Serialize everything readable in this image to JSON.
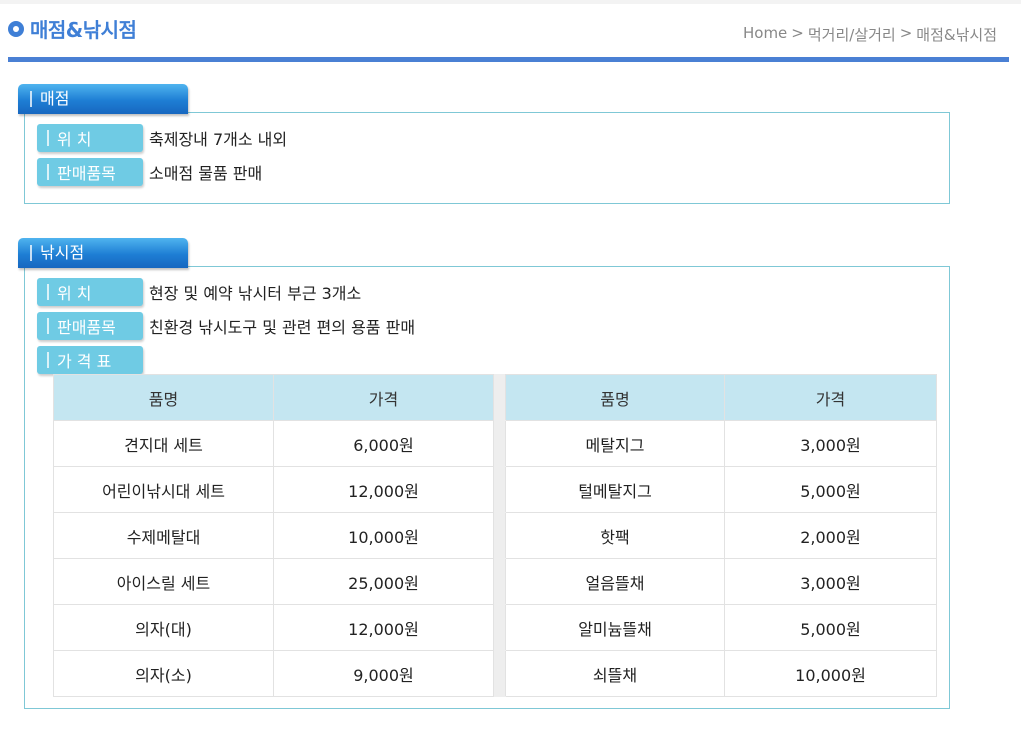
{
  "header": {
    "title": "매점&낚시점",
    "breadcrumb": [
      "Home",
      "먹거리/살거리",
      "매점&낚시점"
    ],
    "breadcrumb_sep": ">"
  },
  "sections": [
    {
      "tab": "매점",
      "rows": [
        {
          "label": "위 치",
          "value": "축제장내 7개소 내외"
        },
        {
          "label": "판매품목",
          "value": "소매점 물품 판매"
        }
      ]
    },
    {
      "tab": "낚시점",
      "rows": [
        {
          "label": "위 치",
          "value": "현장 및 예약 낚시터 부근 3개소"
        },
        {
          "label": "판매품목",
          "value": "친환경 낚시도구 및 관련 편의 용품 판매"
        },
        {
          "label": "가 격 표",
          "value": ""
        }
      ],
      "table": {
        "headers": [
          "품명",
          "가격",
          "품명",
          "가격"
        ],
        "rows": [
          [
            "견지대 세트",
            "6,000원",
            "메탈지그",
            "3,000원"
          ],
          [
            "어린이낚시대 세트",
            "12,000원",
            "털메탈지그",
            "5,000원"
          ],
          [
            "수제메탈대",
            "10,000원",
            "핫팩",
            "2,000원"
          ],
          [
            "아이스릴 세트",
            "25,000원",
            "얼음뜰채",
            "3,000원"
          ],
          [
            "의자(대)",
            "12,000원",
            "알미늄뜰채",
            "5,000원"
          ],
          [
            "의자(소)",
            "9,000원",
            "쇠뜰채",
            "10,000원"
          ]
        ]
      }
    }
  ],
  "colors": {
    "title": "#3f7fd6",
    "title_bar": "#4a80d4",
    "section_tab": "#1e7ed4",
    "label_bg": "#6fcbe4",
    "table_header_bg": "#c4e6f1",
    "box_border": "#7fc8d6"
  },
  "icons": {
    "title_bullet": "circle-bullet-icon"
  }
}
